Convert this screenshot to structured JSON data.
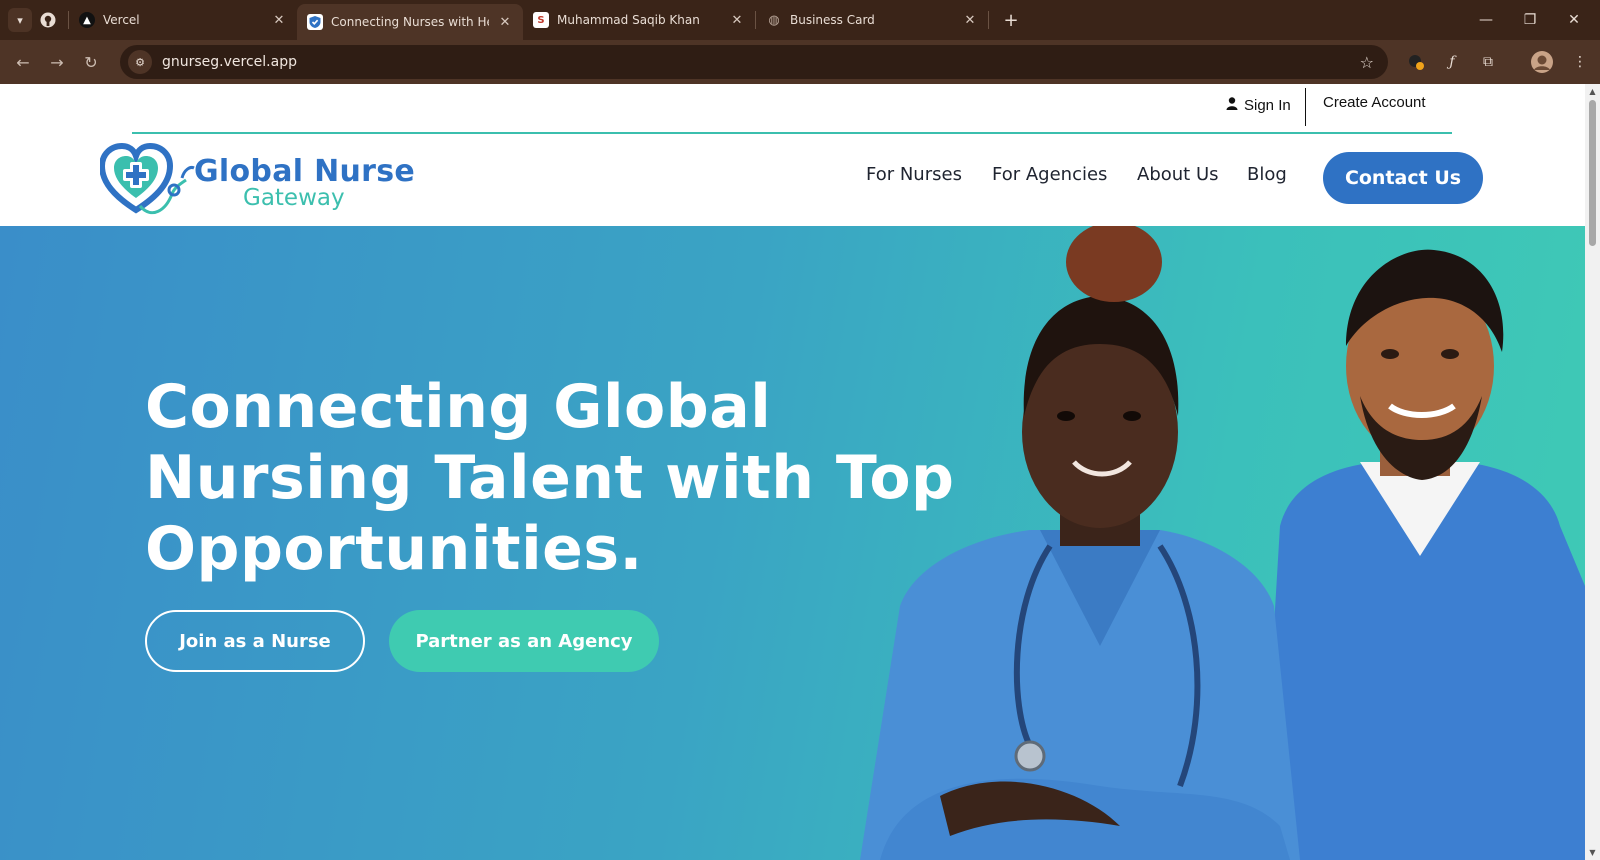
{
  "browser": {
    "tabs": [
      {
        "title": "Vercel",
        "icon": "vercel-icon",
        "active": false
      },
      {
        "title": "Connecting Nurses with Health",
        "icon": "shield-icon",
        "active": true
      },
      {
        "title": "Muhammad Saqib Khan",
        "icon": "s-icon",
        "active": false
      },
      {
        "title": "Business Card",
        "icon": "globe-icon",
        "active": false
      }
    ],
    "url": "gnurseg.vercel.app",
    "colors": {
      "tabbar": "#3a2418",
      "toolbar": "#4e3426"
    }
  },
  "site": {
    "auth": {
      "sign_in": "Sign In",
      "create_account": "Create Account"
    },
    "logo": {
      "line1": "Global Nurse",
      "line2": "Gateway"
    },
    "nav": {
      "for_nurses": "For Nurses",
      "for_agencies": "For Agencies",
      "about_us": "About Us",
      "blog": "Blog",
      "contact": "Contact Us"
    },
    "hero": {
      "title_line1": "Connecting Global",
      "title_line2": "Nursing Talent with Top",
      "title_line3": "Opportunities.",
      "join_button": "Join as a Nurse",
      "partner_button": "Partner as an Agency"
    },
    "colors": {
      "primary_blue": "#2f72c4",
      "teal": "#3bbfae",
      "text_dark": "#1f2430"
    }
  }
}
